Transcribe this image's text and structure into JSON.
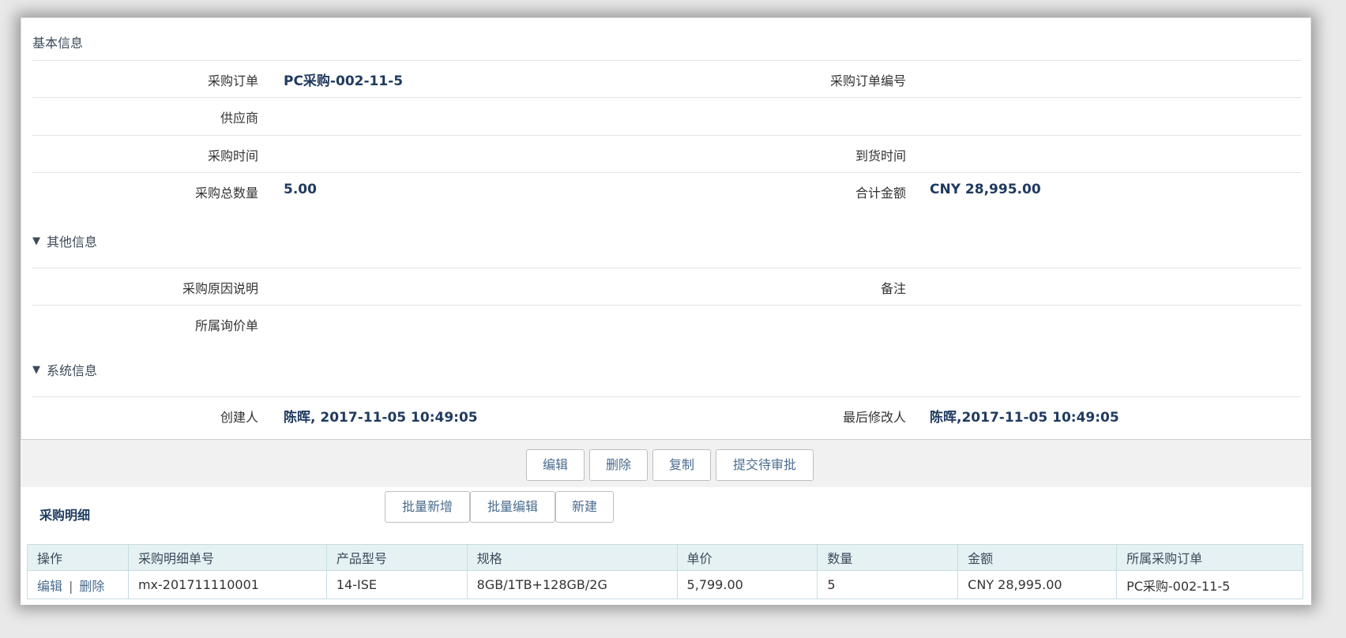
{
  "basic": {
    "title": "基本信息",
    "fields": {
      "po_label": "采购订单",
      "po_value": "PC采购-002-11-5",
      "po_no_label": "采购订单编号",
      "po_no_value": "",
      "supplier_label": "供应商",
      "supplier_value": "",
      "purchase_time_label": "采购时间",
      "purchase_time_value": "",
      "arrival_time_label": "到货时间",
      "arrival_time_value": "",
      "total_qty_label": "采购总数量",
      "total_qty_value": "5.00",
      "total_amount_label": "合计金额",
      "total_amount_value": "CNY 28,995.00"
    }
  },
  "other": {
    "title": "其他信息",
    "toggle": "▼",
    "fields": {
      "reason_label": "采购原因说明",
      "reason_value": "",
      "remark_label": "备注",
      "remark_value": "",
      "inquiry_label": "所属询价单",
      "inquiry_value": ""
    }
  },
  "system": {
    "title": "系统信息",
    "toggle": "▼",
    "fields": {
      "creator_label": "创建人",
      "creator_value": "陈晖, 2017-11-05 10:49:05",
      "modifier_label": "最后修改人",
      "modifier_value": "陈晖,2017-11-05 10:49:05"
    }
  },
  "actions": {
    "edit": "编辑",
    "delete": "删除",
    "copy": "复制",
    "submit": "提交待审批"
  },
  "detail": {
    "title": "采购明细",
    "batch_add": "批量新增",
    "batch_edit": "批量编辑",
    "new": "新建",
    "columns": [
      "操作",
      "采购明细单号",
      "产品型号",
      "规格",
      "单价",
      "数量",
      "金额",
      "所属采购订单"
    ],
    "rows": [
      {
        "op_edit": "编辑",
        "op_sep": "|",
        "op_delete": "删除",
        "detail_no": "mx-201711110001",
        "model": "14-ISE",
        "spec": "8GB/1TB+128GB/2G",
        "unit_price": "5,799.00",
        "qty": "5",
        "amount": "CNY 28,995.00",
        "order": "PC采购-002-11-5"
      }
    ]
  }
}
